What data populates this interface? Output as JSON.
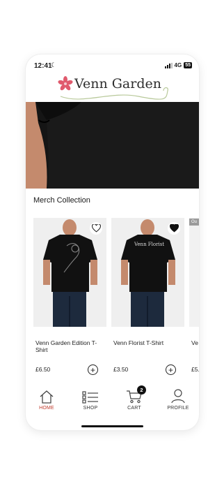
{
  "status": {
    "time": "12:41",
    "network": "4G",
    "battery": "55"
  },
  "brand": {
    "name": "Venn Garden",
    "accent": "#e05a6d",
    "vine": "#b8c99a"
  },
  "section": {
    "title": "Merch Collection"
  },
  "products": [
    {
      "name": "Venn Garden Edition T-Shirt",
      "price": "£6.50",
      "wishlisted": false,
      "shirt_print": ""
    },
    {
      "name": "Venn Florist T-Shirt",
      "price": "£3.50",
      "wishlisted": true,
      "shirt_print": "Venn Florist"
    },
    {
      "name": "Ve",
      "price": "£5.",
      "badge": "Ou"
    }
  ],
  "tabs": [
    {
      "label": "HOME",
      "icon": "home-icon",
      "active": true
    },
    {
      "label": "SHOP",
      "icon": "list-icon",
      "active": false
    },
    {
      "label": "CART",
      "icon": "cart-icon",
      "active": false,
      "badge": "2"
    },
    {
      "label": "PROFILE",
      "icon": "profile-icon",
      "active": false
    }
  ],
  "colors": {
    "active_tab": "#c0392b",
    "shirt": "#111111"
  }
}
